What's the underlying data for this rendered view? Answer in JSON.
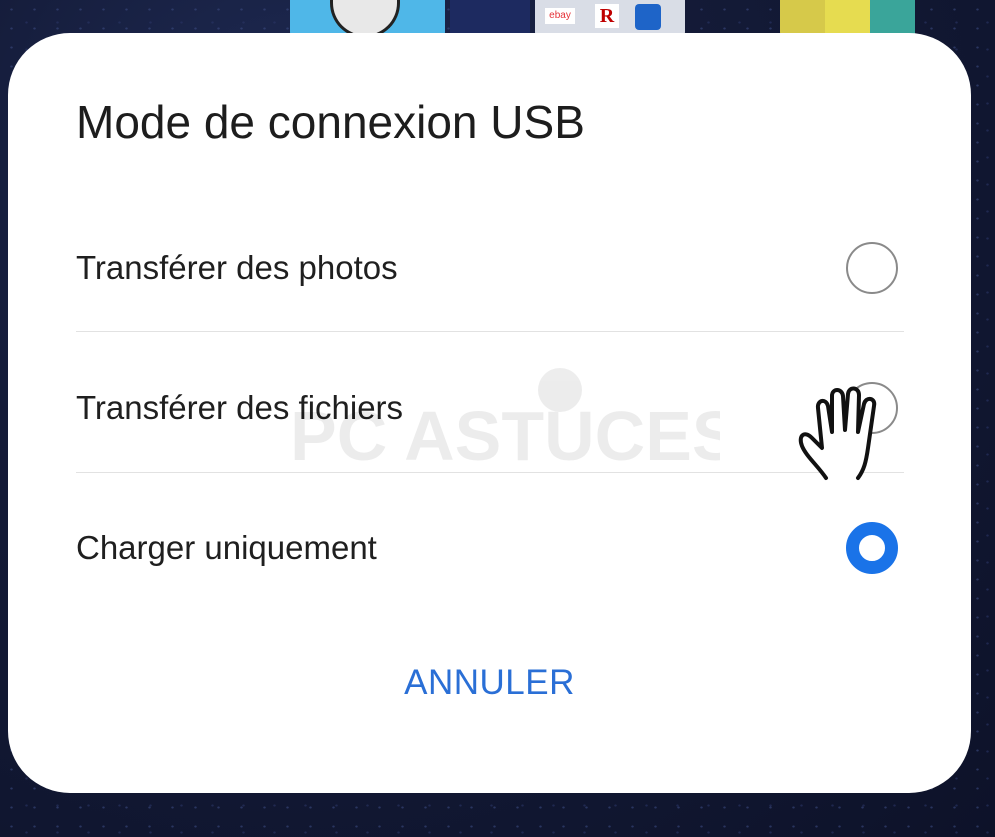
{
  "dialog": {
    "title": "Mode de connexion USB",
    "options": [
      {
        "label": "Transférer des photos",
        "selected": false
      },
      {
        "label": "Transférer des fichiers",
        "selected": false
      },
      {
        "label": "Charger uniquement",
        "selected": true
      }
    ],
    "cancel_label": "ANNULER"
  },
  "background_icons": {
    "shop_ebay": "ebay",
    "shop_rakuten": "R"
  },
  "watermark": {
    "text": "PC ASTUCES"
  },
  "colors": {
    "accent": "#1a73e8",
    "cancel_text": "#2a6fd6",
    "dialog_bg": "#ffffff"
  }
}
